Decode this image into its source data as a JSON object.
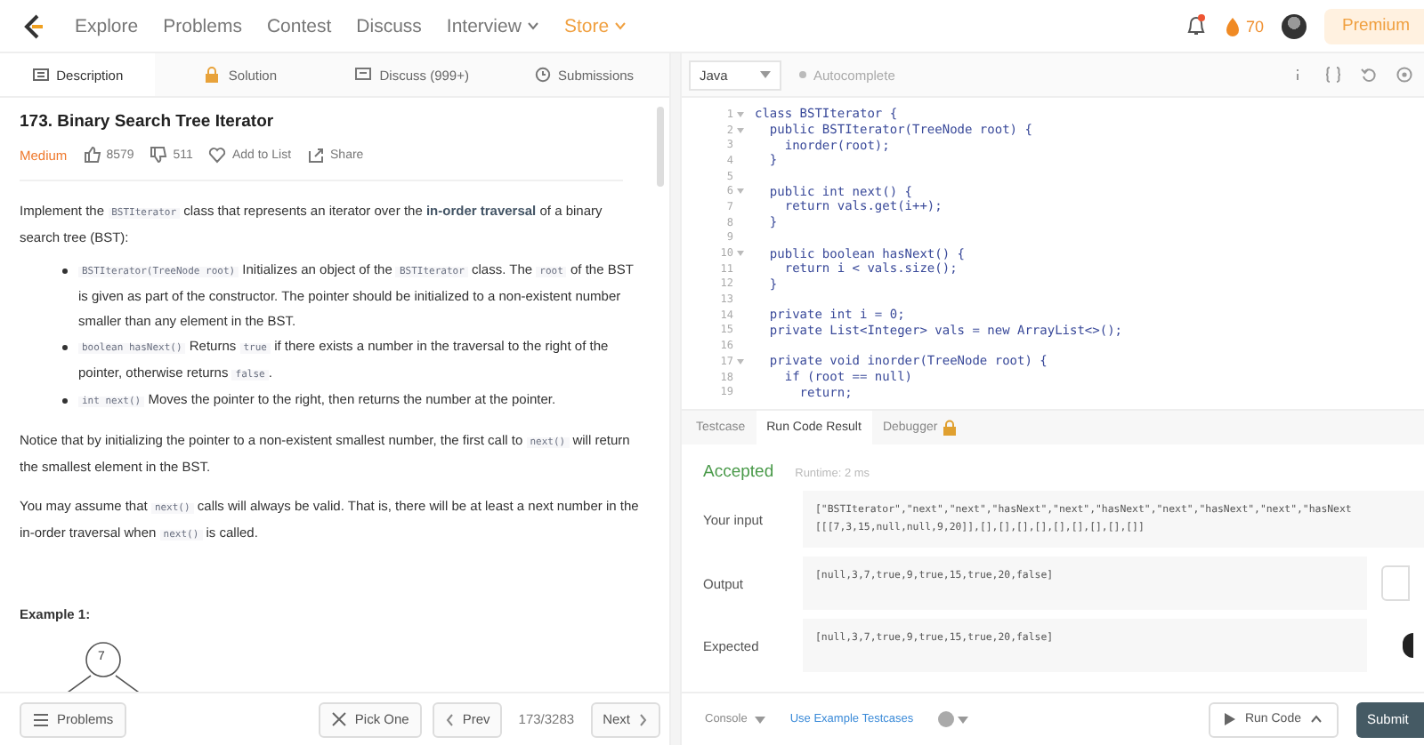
{
  "nav": {
    "items": [
      {
        "label": "Explore",
        "kind": "link"
      },
      {
        "label": "Problems",
        "kind": "link"
      },
      {
        "label": "Contest",
        "kind": "link"
      },
      {
        "label": "Discuss",
        "kind": "link"
      },
      {
        "label": "Interview",
        "kind": "menu"
      },
      {
        "label": "Store",
        "kind": "store"
      }
    ],
    "streak": "70",
    "notification": true,
    "premium": "Premium"
  },
  "tabs": [
    {
      "label": "Description",
      "selected": true
    },
    {
      "label": "Solution",
      "selected": false
    },
    {
      "label": "Discuss (999+)",
      "selected": false
    },
    {
      "label": "Submissions",
      "selected": false
    }
  ],
  "problem": {
    "title": "173. Binary Search Tree Iterator",
    "difficulty": "Medium",
    "likes": "8579",
    "dislikes": "511",
    "add_to_list": "Add to List",
    "share": "Share",
    "blocks": [
      {
        "kind": "para",
        "segments": [
          {
            "t": "Implement the "
          },
          {
            "t": "BSTIterator",
            "code": true
          },
          {
            "t": " class that represents an iterator over the "
          },
          {
            "t": "in-order traversal",
            "bold": true
          },
          {
            "t": " of a binary search tree (BST):"
          }
        ]
      },
      {
        "kind": "bullets",
        "items": [
          [
            {
              "t": "BSTIterator(TreeNode root)",
              "code": true
            },
            {
              "t": " Initializes an object of the "
            },
            {
              "t": "BSTIterator",
              "code": true
            },
            {
              "t": " class. The "
            },
            {
              "t": "root",
              "code": true
            },
            {
              "t": " of the BST is given as part of the constructor. The pointer should be initialized to a non-existent number smaller than any element in the BST."
            }
          ],
          [
            {
              "t": "boolean hasNext()",
              "code": true
            },
            {
              "t": " Returns "
            },
            {
              "t": "true",
              "code": true
            },
            {
              "t": " if there exists a number in the traversal to the right of the pointer, otherwise returns "
            },
            {
              "t": "false",
              "code": true
            },
            {
              "t": "."
            }
          ],
          [
            {
              "t": "int next()",
              "code": true
            },
            {
              "t": " Moves the pointer to the right, then returns the number at the pointer."
            }
          ]
        ]
      },
      {
        "kind": "para",
        "segments": [
          {
            "t": "Notice that by initializing the pointer to a non-existent smallest number, the first call to "
          },
          {
            "t": "next()",
            "code": true
          },
          {
            "t": " will return the smallest element in the BST."
          }
        ]
      },
      {
        "kind": "para",
        "segments": [
          {
            "t": "You may assume that "
          },
          {
            "t": "next()",
            "code": true
          },
          {
            "t": " calls will always be valid. That is, there will be at least a next number in the in-order traversal when "
          },
          {
            "t": "next()",
            "code": true
          },
          {
            "t": " is called."
          }
        ]
      }
    ],
    "example_title": "Example 1:",
    "tree_root": "7"
  },
  "left_footer": {
    "problems": "Problems",
    "pick_one": "Pick One",
    "prev": "Prev",
    "counter": "173/3283",
    "next": "Next"
  },
  "editor": {
    "language": "Java",
    "autocomplete": "Autocomplete",
    "autocomplete_on": false,
    "lines": [
      {
        "n": "1",
        "fold": true,
        "code": "class BSTIterator {"
      },
      {
        "n": "2",
        "fold": true,
        "code": "  public BSTIterator(TreeNode root) {"
      },
      {
        "n": "3",
        "fold": false,
        "code": "    inorder(root);"
      },
      {
        "n": "4",
        "fold": false,
        "code": "  }"
      },
      {
        "n": "5",
        "fold": false
      },
      {
        "n": "6",
        "fold": true,
        "code": "  public int next() {"
      },
      {
        "n": "7",
        "fold": false,
        "code": "    return vals.get(i++);"
      },
      {
        "n": "8",
        "fold": false,
        "code": "  }"
      },
      {
        "n": "9",
        "fold": false
      },
      {
        "n": "10",
        "fold": true,
        "code": "  public boolean hasNext() {"
      },
      {
        "n": "11",
        "fold": false,
        "code": "    return i < vals.size();"
      },
      {
        "n": "12",
        "fold": false,
        "code": "  }"
      },
      {
        "n": "13",
        "fold": false
      },
      {
        "n": "14",
        "fold": false,
        "code": "  private int i = 0;"
      },
      {
        "n": "15",
        "fold": false,
        "code": "  private List<Integer> vals = new ArrayList<>();"
      },
      {
        "n": "16",
        "fold": false
      },
      {
        "n": "17",
        "fold": true,
        "code": "  private void inorder(TreeNode root) {"
      },
      {
        "n": "18",
        "fold": false,
        "code": "    if (root == null)"
      },
      {
        "n": "19",
        "fold": false,
        "code": "      return;"
      }
    ]
  },
  "console_tabs": [
    {
      "label": "Testcase",
      "selected": false,
      "locked": false
    },
    {
      "label": "Run Code Result",
      "selected": true,
      "locked": false
    },
    {
      "label": "Debugger",
      "selected": false,
      "locked": true
    }
  ],
  "result": {
    "status": "Accepted",
    "runtime": "Runtime: 2 ms",
    "rows": [
      {
        "label": "Your input",
        "lines": [
          "[\"BSTIterator\",\"next\",\"next\",\"hasNext\",\"next\",\"hasNext\",\"next\",\"hasNext\",\"next\",\"hasNext",
          "[[[7,3,15,null,null,9,20]],[],[],[],[],[],[],[],[],[]]"
        ]
      },
      {
        "label": "Output",
        "lines": [
          "[null,3,7,true,9,true,15,true,20,false]"
        ]
      },
      {
        "label": "Expected",
        "lines": [
          "[null,3,7,true,9,true,15,true,20,false]"
        ]
      }
    ]
  },
  "right_footer": {
    "console": "Console",
    "example_testcases": "Use Example Testcases",
    "run_code": "Run Code",
    "submit": "Submit"
  }
}
